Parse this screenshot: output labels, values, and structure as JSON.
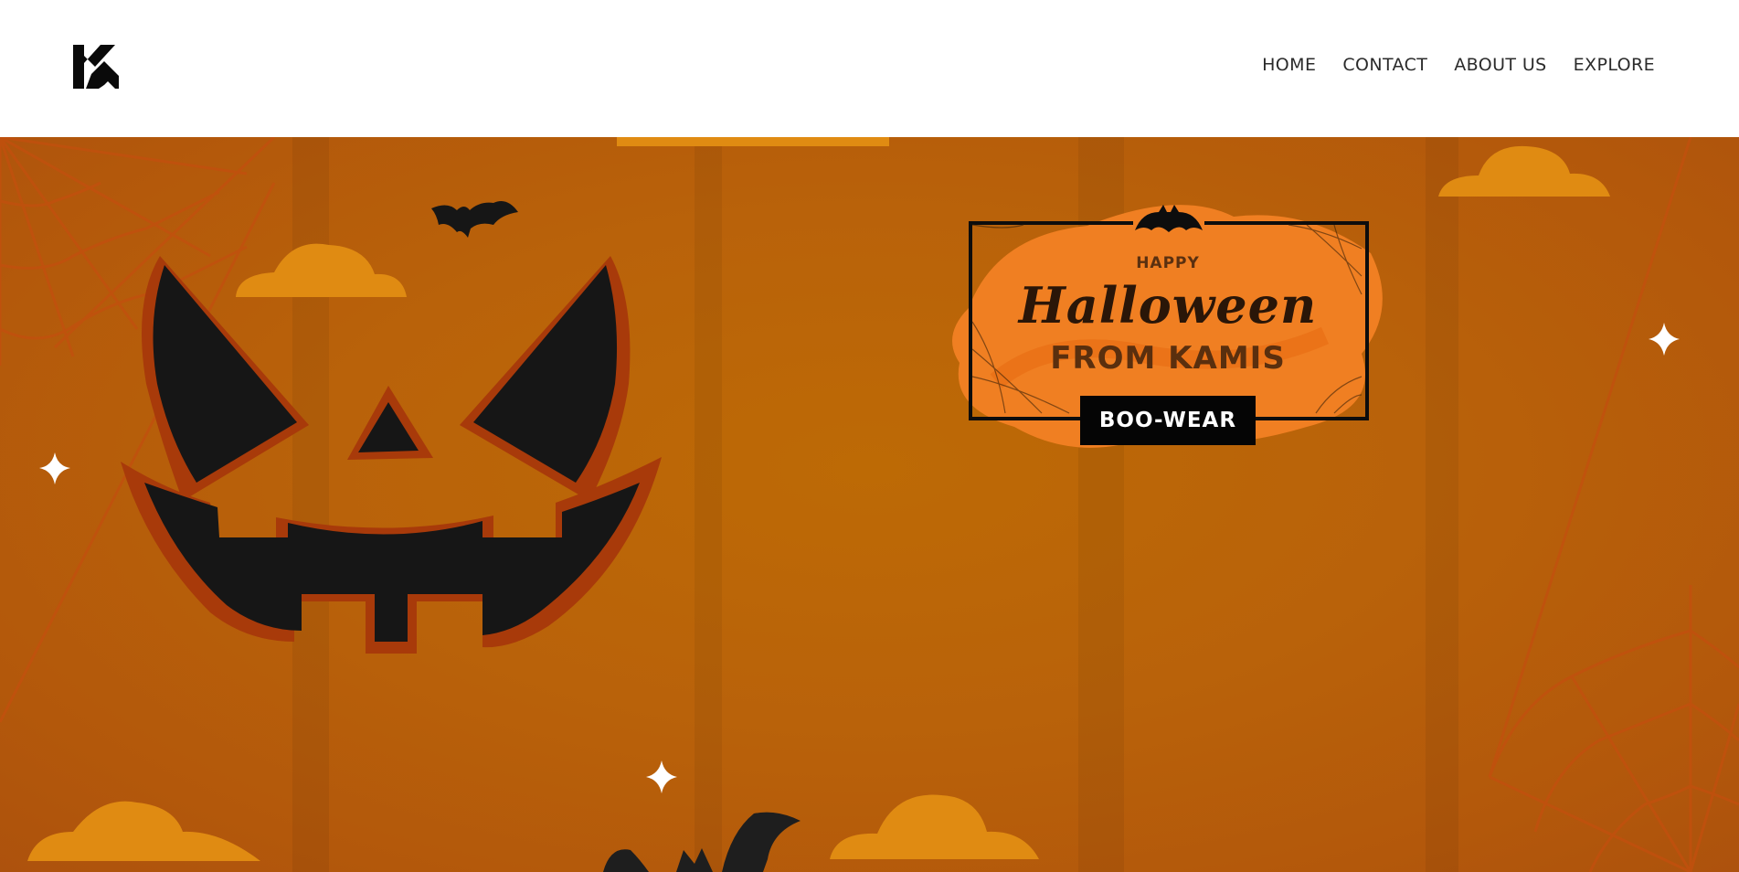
{
  "header": {
    "logo_alt": "KM",
    "nav": [
      {
        "label": "HOME"
      },
      {
        "label": "CONTACT"
      },
      {
        "label": "ABOUT US"
      },
      {
        "label": "EXPLORE"
      }
    ]
  },
  "hero": {
    "card": {
      "line1": "HAPPY",
      "line2": "Halloween",
      "line3": "FROM  KAMIS",
      "badge": "BOO-WEAR"
    }
  },
  "colors": {
    "background": "#b9620a",
    "pumpkin_outline": "#a83a0a",
    "face": "#161616",
    "cloud": "#e08b12",
    "card_brush": "#f07f22",
    "badge": "#050505"
  },
  "icons": [
    "logo-icon",
    "bat-icon",
    "sparkle-icon",
    "cobweb-icon",
    "cloud-icon"
  ]
}
